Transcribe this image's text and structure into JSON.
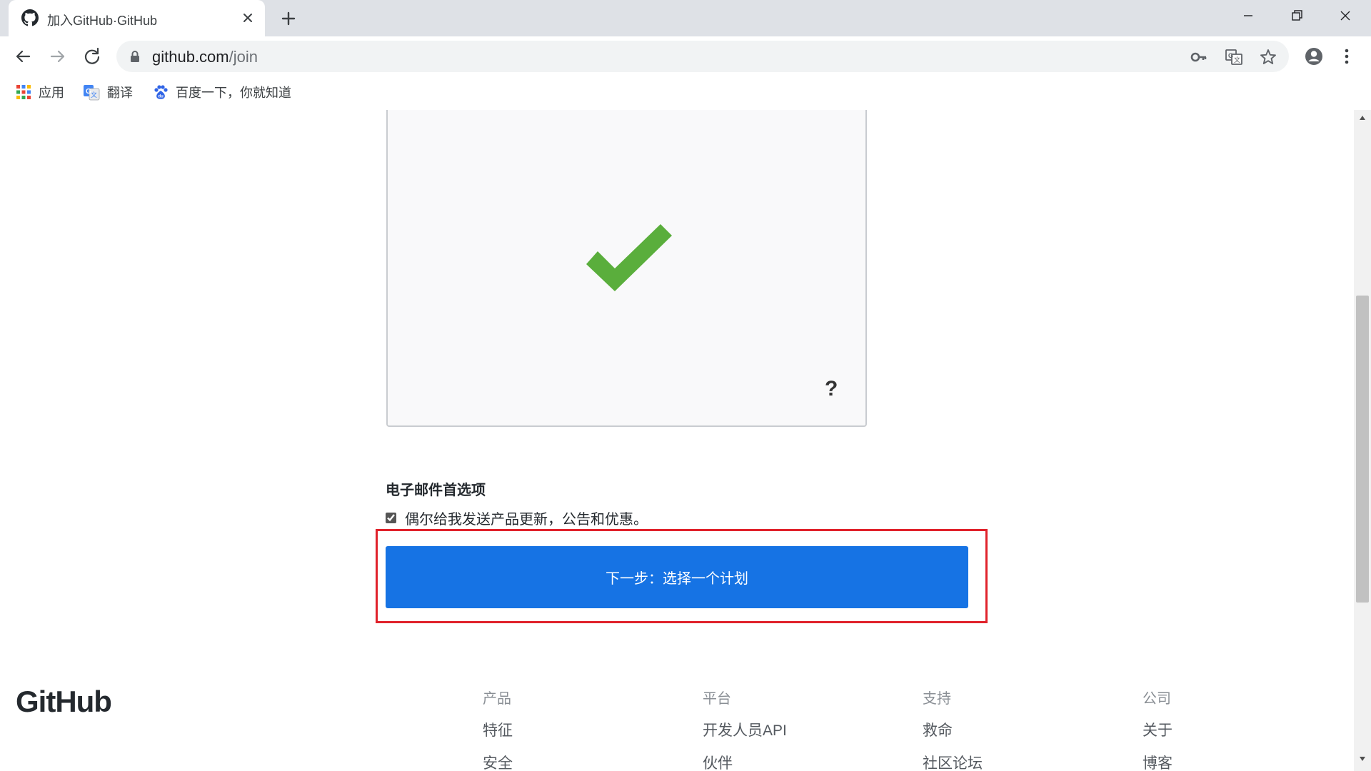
{
  "browser": {
    "tab_title": "加入GitHub·GitHub",
    "url_host": "github.com",
    "url_path": "/join",
    "bookmarks": [
      {
        "label": "应用",
        "icon": "apps-grid-icon"
      },
      {
        "label": "翻译",
        "icon": "google-translate-icon"
      },
      {
        "label": "百度一下，你就知道",
        "icon": "baidu-paw-icon"
      }
    ]
  },
  "captcha": {
    "status_icon": "green-checkmark-icon",
    "help_label": "?",
    "check_color": "#5aae3c"
  },
  "email_prefs": {
    "title": "电子邮件首选项",
    "option_label": "偶尔给我发送产品更新，公告和优惠。",
    "option_checked": true
  },
  "next_button": {
    "label": "下一步：选择一个计划",
    "color": "#1673e4"
  },
  "highlight": {
    "color": "#e0222b"
  },
  "footer": {
    "logo_text": "GitHub",
    "columns": [
      {
        "heading": "产品",
        "links": [
          "特征",
          "安全"
        ]
      },
      {
        "heading": "平台",
        "links": [
          "开发人员API",
          "伙伴"
        ]
      },
      {
        "heading": "支持",
        "links": [
          "救命",
          "社区论坛"
        ]
      },
      {
        "heading": "公司",
        "links": [
          "关于",
          "博客"
        ]
      }
    ]
  }
}
